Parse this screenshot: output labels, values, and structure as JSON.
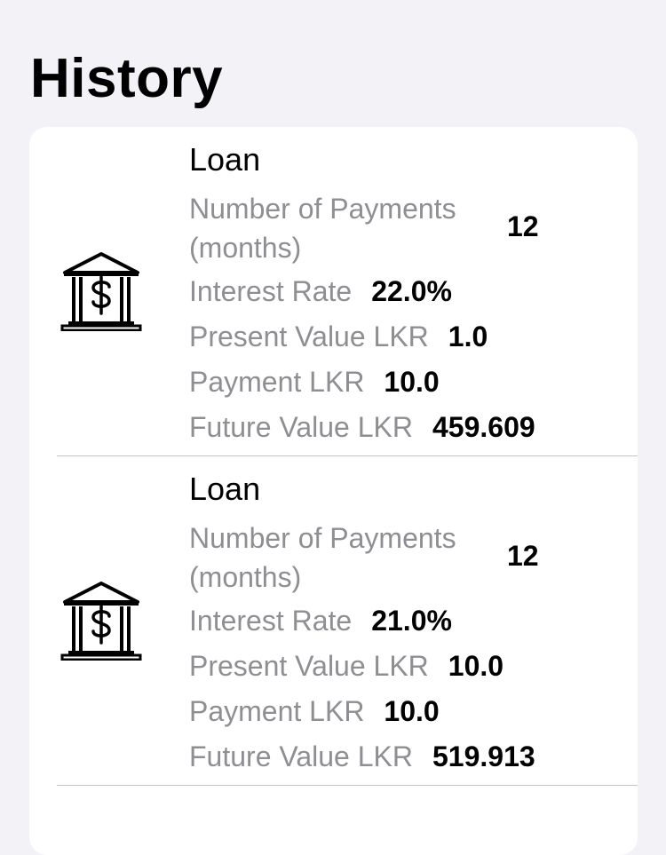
{
  "header": {
    "title": "History"
  },
  "history": {
    "entries": [
      {
        "title": "Loan",
        "icon": "bank-dollar-icon",
        "payments_label": "Number of Payments (months)",
        "payments_value": "12",
        "interest_label": "Interest Rate",
        "interest_value": "22.0%",
        "present_label": "Present Value LKR",
        "present_value": "1.0",
        "payment_label": "Payment LKR",
        "payment_value": "10.0",
        "future_label": "Future Value LKR",
        "future_value": "459.609"
      },
      {
        "title": "Loan",
        "icon": "bank-dollar-icon",
        "payments_label": "Number of Payments (months)",
        "payments_value": "12",
        "interest_label": "Interest Rate",
        "interest_value": "21.0%",
        "present_label": "Present Value LKR",
        "present_value": "10.0",
        "payment_label": "Payment LKR",
        "payment_value": "10.0",
        "future_label": "Future Value LKR",
        "future_value": "519.913"
      }
    ]
  },
  "colors": {
    "background": "#f2f2f7",
    "card": "#ffffff",
    "label_gray": "#8e8e93",
    "value_black": "#000000",
    "divider": "#c6c6c8"
  }
}
